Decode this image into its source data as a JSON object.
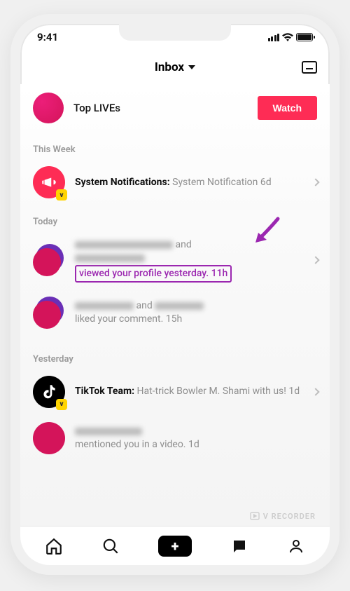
{
  "status": {
    "time": "9:41"
  },
  "header": {
    "title": "Inbox"
  },
  "live": {
    "title": "Top LIVEs",
    "watch_label": "Watch"
  },
  "sections": {
    "this_week": "This Week",
    "today": "Today",
    "yesterday": "Yesterday"
  },
  "notifs": {
    "system": {
      "title": "System Notifications:",
      "body": "System Notification",
      "time": "6d"
    },
    "profile_view": {
      "connector": "and",
      "action_highlighted": "viewed your profile yesterday. 11h"
    },
    "liked": {
      "connector": "and",
      "action": "liked your comment.",
      "time": "15h"
    },
    "tiktok_team": {
      "title": "TikTok Team:",
      "body": "Hat-trick Bowler M. Shami with us!",
      "time": "1d"
    },
    "mention": {
      "action": "mentioned you in a video.",
      "time": "1d"
    }
  },
  "watermark": "V RECORDER"
}
